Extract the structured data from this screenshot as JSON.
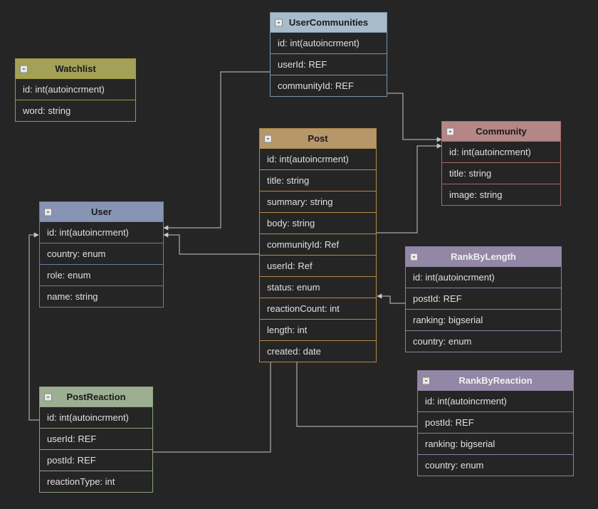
{
  "entities": {
    "watchlist": {
      "title": "Watchlist",
      "idrow": "id: int(autoincrment)",
      "rows": [
        "word: string"
      ]
    },
    "user": {
      "title": "User",
      "idrow": "id: int(autoincrment)",
      "rows": [
        "country: enum",
        "role: enum",
        "name: string"
      ]
    },
    "usercommunities": {
      "title": "UserCommunities",
      "idrow": "id: int(autoincrment)",
      "rows": [
        "userId: REF",
        "communityId: REF"
      ]
    },
    "post": {
      "title": "Post",
      "idrow": "id: int(autoincrment)",
      "rows": [
        "title: string",
        "summary: string",
        "body: string",
        "communityId: Ref",
        "userId: Ref",
        "status: enum",
        "reactionCount: int",
        "length: int",
        "created: date"
      ]
    },
    "community": {
      "title": "Community",
      "idrow": "id: int(autoincrment)",
      "rows": [
        "title: string",
        "image: string"
      ]
    },
    "rankbylength": {
      "title": "RankByLength",
      "idrow": "id: int(autoincrment)",
      "rows": [
        "postId: REF",
        "ranking: bigserial",
        "country: enum"
      ]
    },
    "rankbyreaction": {
      "title": "RankByReaction",
      "idrow": "id: int(autoincrment)",
      "rows": [
        "postId: REF",
        "ranking: bigserial",
        "country: enum"
      ]
    },
    "postreaction": {
      "title": "PostReaction",
      "idrow": "id: int(autoincrment)",
      "rows": [
        "userId: REF",
        "postId: REF",
        "reactionType: int"
      ]
    }
  }
}
